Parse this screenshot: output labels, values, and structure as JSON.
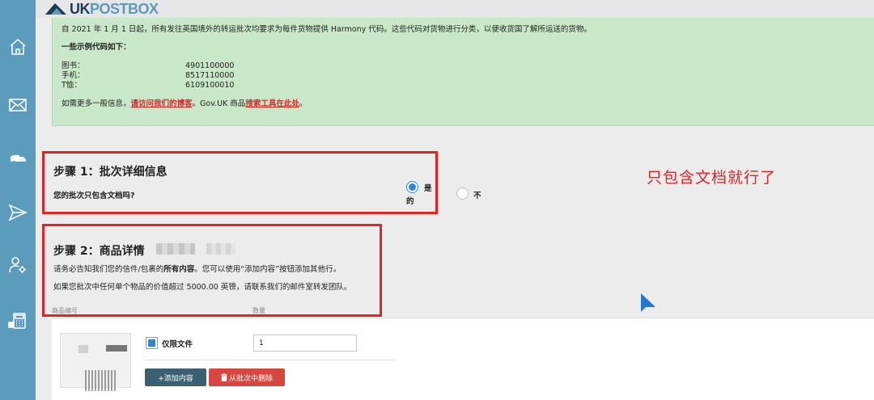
{
  "brand": {
    "uk": "UK",
    "postbox": "POSTBOX"
  },
  "sidebar": {
    "items": [
      {
        "icon": "home-icon"
      },
      {
        "icon": "mail-icon"
      },
      {
        "icon": "truck-icon"
      },
      {
        "icon": "send-icon"
      },
      {
        "icon": "user-settings-icon"
      },
      {
        "icon": "calculator-icon"
      }
    ]
  },
  "notice": {
    "intro": "自 2021 年 1 月 1 日起，所有发往英国境外的转运批次均要求为每件货物提供 Harmony 代码。这些代码对货物进行分类，以便收货国了解所运送的货物。",
    "subhead": "一些示例代码如下：",
    "codes": [
      {
        "name": "图书：",
        "code": "4901100000"
      },
      {
        "name": "手机：",
        "code": "8517110000"
      },
      {
        "name": "T恤：",
        "code": "6109100010"
      }
    ],
    "more_prefix": "如需更多一般信息，",
    "blog_link": "请访问我们的博客",
    "more_middle": "。Gov.UK 商品",
    "search_link": "搜索工具在此处",
    "more_suffix": "。"
  },
  "step1": {
    "title": "步骤 1：批次详细信息",
    "question": "您的批次只包含文档吗?",
    "options": [
      {
        "label_a": "是",
        "label_b": "的",
        "checked": true
      },
      {
        "label": "不",
        "checked": false
      }
    ]
  },
  "annotation": "只包含文档就行了",
  "step2": {
    "title": "步骤 2：商品详情",
    "p1_prefix": "请务必告知我们您的信件/包裹的",
    "p1_bold": "所有内容",
    "p1_suffix": "。您可以使用“添加内容”按钮添加其他行。",
    "p2": "如果您批次中任何单个物品的价值超过 5000.00 英镑，请联系我们的邮件室转发团队。",
    "col_code": "商品编号",
    "col_qty": "数量"
  },
  "item": {
    "documents_only_label": "仅限文件",
    "documents_only_checked": true,
    "quantity": "1",
    "add_button": "+添加内容",
    "delete_button": "从批次中删除",
    "delete_icon": "trash-icon"
  },
  "colors": {
    "sidebar": "#5b9bbb",
    "notice_bg": "#c9e8c9",
    "highlight_border": "#e02424",
    "accent_blue": "#2f86d6",
    "add_button": "#3a6072",
    "delete_button": "#d9453f"
  }
}
